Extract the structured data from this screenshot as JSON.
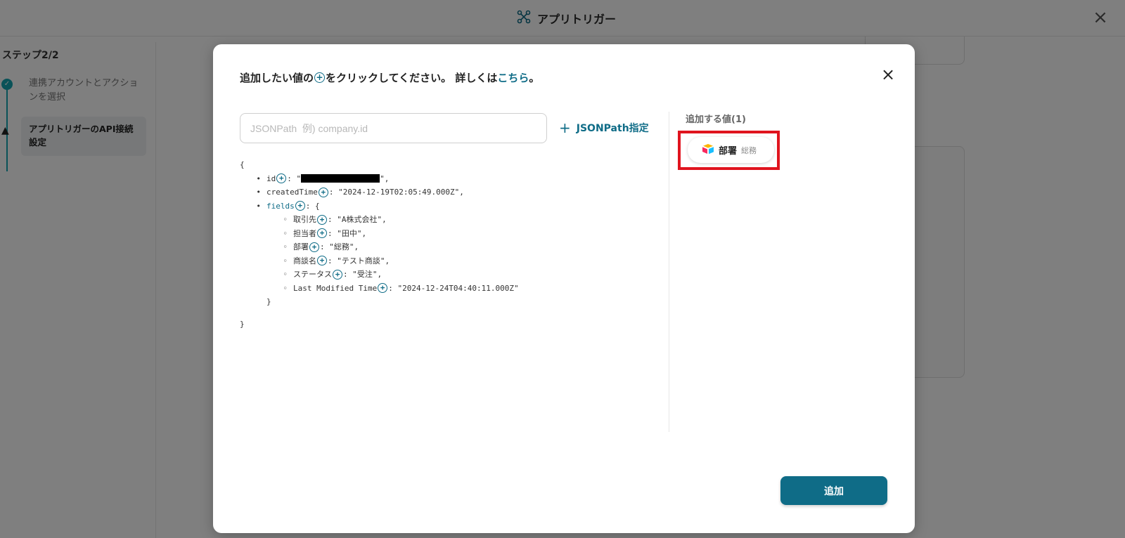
{
  "app": {
    "title": "アプリトリガー",
    "close_icon": "close-icon"
  },
  "sidebar": {
    "step_title": "ステップ2/2",
    "steps": [
      {
        "label": "連携アカウントとアクションを選択",
        "status": "done"
      },
      {
        "label": "アプリトリガーのAPI接続設定",
        "status": "warning"
      }
    ]
  },
  "modal": {
    "heading_before": "追加したい値の",
    "heading_after": "をクリックしてください。 詳しくは",
    "heading_link": "こちら",
    "heading_end": "。",
    "input_placeholder": "JSONPath  例) company.id",
    "input_value": "",
    "jsonpath_button": "JSONPath指定",
    "json": {
      "open": "{",
      "close": "}",
      "fields_close": "}",
      "rows": [
        {
          "key": "id",
          "suffix": "\",",
          "redacted": true
        },
        {
          "key": "createdTime",
          "value": ": \"2024-12-19T02:05:49.000Z\","
        },
        {
          "key": "fields",
          "value": ": {"
        }
      ],
      "field_rows": [
        {
          "key": "取引先",
          "value": ": \"A株式会社\","
        },
        {
          "key": "担当者",
          "value": ": \"田中\","
        },
        {
          "key": "部署",
          "value": ": \"総務\","
        },
        {
          "key": "商談名",
          "value": ": \"テスト商談\","
        },
        {
          "key": "ステータス",
          "value": ": \"受注\","
        },
        {
          "key": "Last Modified Time",
          "value": ": \"2024-12-24T04:40:11.000Z\""
        }
      ]
    },
    "added_title": "追加する値(1)",
    "added_values": [
      {
        "label": "部署",
        "value": "総務",
        "icon": "airtable-icon"
      }
    ],
    "add_button": "追加"
  },
  "colors": {
    "accent": "#0f6c87",
    "highlight": "#e0141e",
    "step_done": "#12a4b0"
  }
}
